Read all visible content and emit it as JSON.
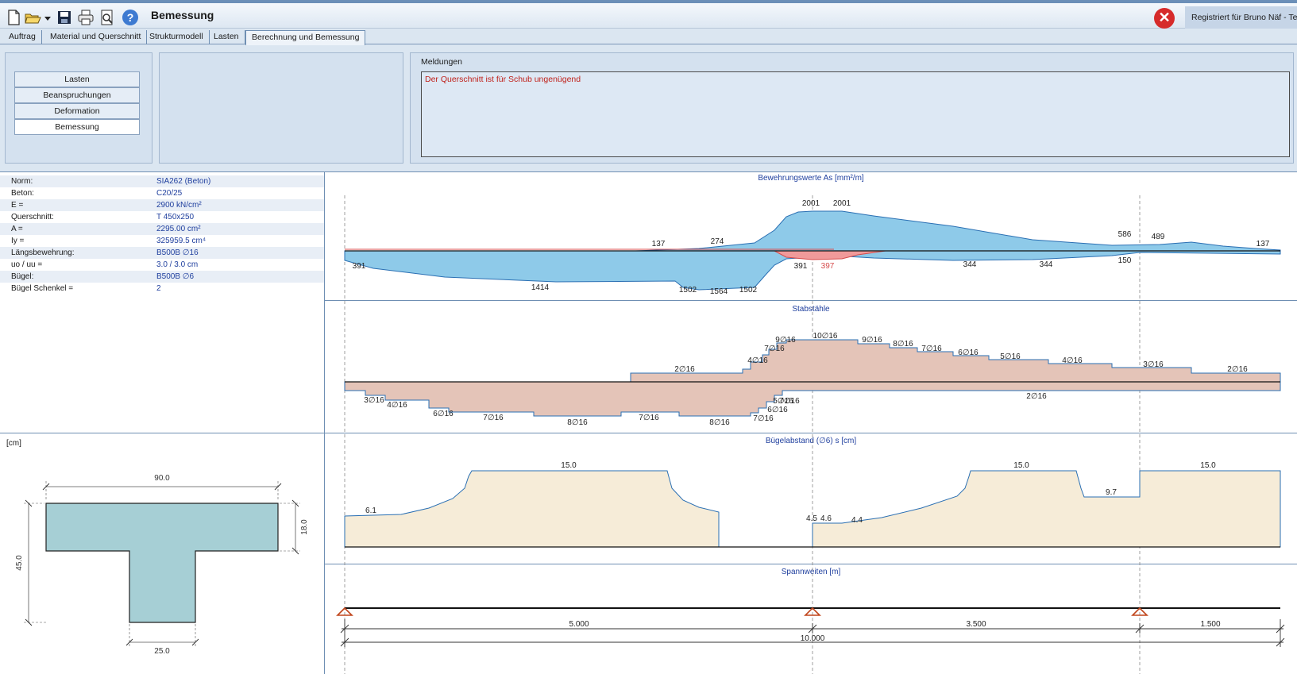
{
  "toolbar": {
    "title": "Bemessung",
    "registered": "Registriert für  Bruno Näf - Test",
    "icons": [
      "new-file-icon",
      "open-folder-icon",
      "save-icon",
      "print-icon",
      "print-preview-icon",
      "help-icon"
    ],
    "close_symbol": "✕"
  },
  "tabs": [
    "Auftrag",
    "Material und Querschnitt",
    "Strukturmodell",
    "Lasten",
    "Berechnung und Bemessung"
  ],
  "menu": [
    "Lasten",
    "Beanspruchungen",
    "Deformation",
    "Bemessung"
  ],
  "messages": {
    "label": "Meldungen",
    "text": "Der Querschnitt ist für Schub ungenügend"
  },
  "properties": [
    {
      "key": "Norm:",
      "value": "SIA262 (Beton)"
    },
    {
      "key": "Beton:",
      "value": "C20/25"
    },
    {
      "key": "E =",
      "value": "2900 kN/cm²"
    },
    {
      "key": "Querschnitt:",
      "value": "T 450x250"
    },
    {
      "key": "A =",
      "value": "2295.00 cm²"
    },
    {
      "key": "Iy =",
      "value": "325959.5 cm⁴"
    },
    {
      "key": "Längsbewehrung:",
      "value": "B500B ∅16"
    },
    {
      "key": "uo / uu =",
      "value": "3.0 / 3.0 cm"
    },
    {
      "key": "Bügel:",
      "value": "B500B ∅6"
    },
    {
      "key": "Bügel Schenkel =",
      "value": "2"
    }
  ],
  "section": {
    "unit": "[cm]",
    "width_top": "90.0",
    "height_total": "45.0",
    "flange_height": "18.0",
    "web_width": "25.0"
  },
  "charts": {
    "reinforcement": {
      "title": "Bewehrungswerte As [mm²/m]",
      "top_labels": [
        "137",
        "274",
        "2001",
        "2001",
        "586",
        "489",
        "137"
      ],
      "bottom_labels": [
        "391",
        "1414",
        "1502",
        "1564",
        "1502",
        "391",
        "344",
        "344",
        "150"
      ],
      "red_label": "397"
    },
    "bars": {
      "title": "Stabstähle",
      "top_labels": [
        "2∅16",
        "4∅16",
        "7∅16",
        "9∅16",
        "10∅16",
        "9∅16",
        "8∅16",
        "7∅16",
        "6∅16",
        "5∅16",
        "4∅16",
        "3∅16",
        "2∅16"
      ],
      "bottom_labels": [
        "3∅16",
        "4∅16",
        "6∅16",
        "7∅16",
        "8∅16",
        "7∅16",
        "8∅16",
        "7∅16",
        "6∅16",
        "5∅16",
        "7∅16",
        "2∅16"
      ]
    },
    "stirrups": {
      "title": "Bügelabstand (∅6) s [cm]",
      "labels": [
        "6.1",
        "15.0",
        "4.5",
        "4.6",
        "4.4",
        "15.0",
        "9.7",
        "15.0"
      ]
    },
    "spans": {
      "title": "Spannweiten [m]",
      "labels": [
        "5.000",
        "3.500",
        "1.500",
        "10.000"
      ]
    }
  }
}
